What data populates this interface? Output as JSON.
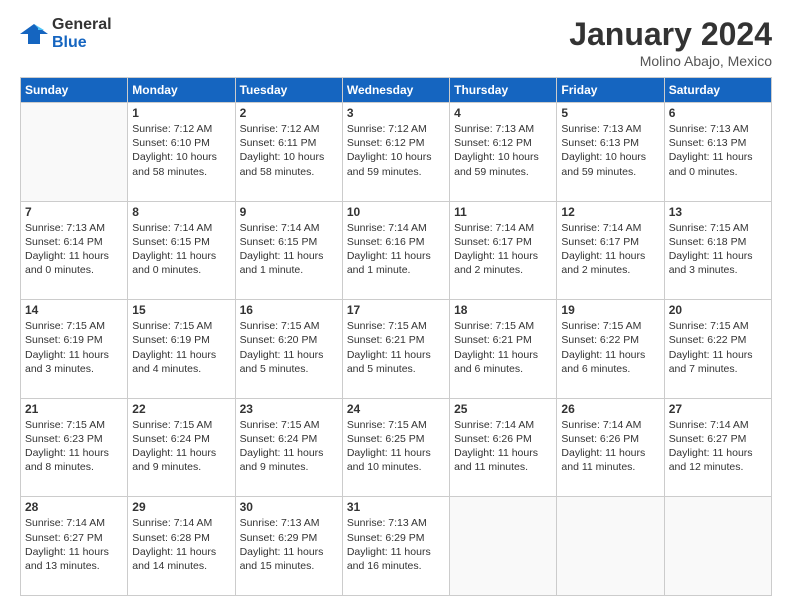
{
  "logo": {
    "general": "General",
    "blue": "Blue"
  },
  "title": "January 2024",
  "subtitle": "Molino Abajo, Mexico",
  "days_header": [
    "Sunday",
    "Monday",
    "Tuesday",
    "Wednesday",
    "Thursday",
    "Friday",
    "Saturday"
  ],
  "weeks": [
    [
      {
        "num": "",
        "info": ""
      },
      {
        "num": "1",
        "info": "Sunrise: 7:12 AM\nSunset: 6:10 PM\nDaylight: 10 hours\nand 58 minutes."
      },
      {
        "num": "2",
        "info": "Sunrise: 7:12 AM\nSunset: 6:11 PM\nDaylight: 10 hours\nand 58 minutes."
      },
      {
        "num": "3",
        "info": "Sunrise: 7:12 AM\nSunset: 6:12 PM\nDaylight: 10 hours\nand 59 minutes."
      },
      {
        "num": "4",
        "info": "Sunrise: 7:13 AM\nSunset: 6:12 PM\nDaylight: 10 hours\nand 59 minutes."
      },
      {
        "num": "5",
        "info": "Sunrise: 7:13 AM\nSunset: 6:13 PM\nDaylight: 10 hours\nand 59 minutes."
      },
      {
        "num": "6",
        "info": "Sunrise: 7:13 AM\nSunset: 6:13 PM\nDaylight: 11 hours\nand 0 minutes."
      }
    ],
    [
      {
        "num": "7",
        "info": "Sunrise: 7:13 AM\nSunset: 6:14 PM\nDaylight: 11 hours\nand 0 minutes."
      },
      {
        "num": "8",
        "info": "Sunrise: 7:14 AM\nSunset: 6:15 PM\nDaylight: 11 hours\nand 0 minutes."
      },
      {
        "num": "9",
        "info": "Sunrise: 7:14 AM\nSunset: 6:15 PM\nDaylight: 11 hours\nand 1 minute."
      },
      {
        "num": "10",
        "info": "Sunrise: 7:14 AM\nSunset: 6:16 PM\nDaylight: 11 hours\nand 1 minute."
      },
      {
        "num": "11",
        "info": "Sunrise: 7:14 AM\nSunset: 6:17 PM\nDaylight: 11 hours\nand 2 minutes."
      },
      {
        "num": "12",
        "info": "Sunrise: 7:14 AM\nSunset: 6:17 PM\nDaylight: 11 hours\nand 2 minutes."
      },
      {
        "num": "13",
        "info": "Sunrise: 7:15 AM\nSunset: 6:18 PM\nDaylight: 11 hours\nand 3 minutes."
      }
    ],
    [
      {
        "num": "14",
        "info": "Sunrise: 7:15 AM\nSunset: 6:19 PM\nDaylight: 11 hours\nand 3 minutes."
      },
      {
        "num": "15",
        "info": "Sunrise: 7:15 AM\nSunset: 6:19 PM\nDaylight: 11 hours\nand 4 minutes."
      },
      {
        "num": "16",
        "info": "Sunrise: 7:15 AM\nSunset: 6:20 PM\nDaylight: 11 hours\nand 5 minutes."
      },
      {
        "num": "17",
        "info": "Sunrise: 7:15 AM\nSunset: 6:21 PM\nDaylight: 11 hours\nand 5 minutes."
      },
      {
        "num": "18",
        "info": "Sunrise: 7:15 AM\nSunset: 6:21 PM\nDaylight: 11 hours\nand 6 minutes."
      },
      {
        "num": "19",
        "info": "Sunrise: 7:15 AM\nSunset: 6:22 PM\nDaylight: 11 hours\nand 6 minutes."
      },
      {
        "num": "20",
        "info": "Sunrise: 7:15 AM\nSunset: 6:22 PM\nDaylight: 11 hours\nand 7 minutes."
      }
    ],
    [
      {
        "num": "21",
        "info": "Sunrise: 7:15 AM\nSunset: 6:23 PM\nDaylight: 11 hours\nand 8 minutes."
      },
      {
        "num": "22",
        "info": "Sunrise: 7:15 AM\nSunset: 6:24 PM\nDaylight: 11 hours\nand 9 minutes."
      },
      {
        "num": "23",
        "info": "Sunrise: 7:15 AM\nSunset: 6:24 PM\nDaylight: 11 hours\nand 9 minutes."
      },
      {
        "num": "24",
        "info": "Sunrise: 7:15 AM\nSunset: 6:25 PM\nDaylight: 11 hours\nand 10 minutes."
      },
      {
        "num": "25",
        "info": "Sunrise: 7:14 AM\nSunset: 6:26 PM\nDaylight: 11 hours\nand 11 minutes."
      },
      {
        "num": "26",
        "info": "Sunrise: 7:14 AM\nSunset: 6:26 PM\nDaylight: 11 hours\nand 11 minutes."
      },
      {
        "num": "27",
        "info": "Sunrise: 7:14 AM\nSunset: 6:27 PM\nDaylight: 11 hours\nand 12 minutes."
      }
    ],
    [
      {
        "num": "28",
        "info": "Sunrise: 7:14 AM\nSunset: 6:27 PM\nDaylight: 11 hours\nand 13 minutes."
      },
      {
        "num": "29",
        "info": "Sunrise: 7:14 AM\nSunset: 6:28 PM\nDaylight: 11 hours\nand 14 minutes."
      },
      {
        "num": "30",
        "info": "Sunrise: 7:13 AM\nSunset: 6:29 PM\nDaylight: 11 hours\nand 15 minutes."
      },
      {
        "num": "31",
        "info": "Sunrise: 7:13 AM\nSunset: 6:29 PM\nDaylight: 11 hours\nand 16 minutes."
      },
      {
        "num": "",
        "info": ""
      },
      {
        "num": "",
        "info": ""
      },
      {
        "num": "",
        "info": ""
      }
    ]
  ]
}
